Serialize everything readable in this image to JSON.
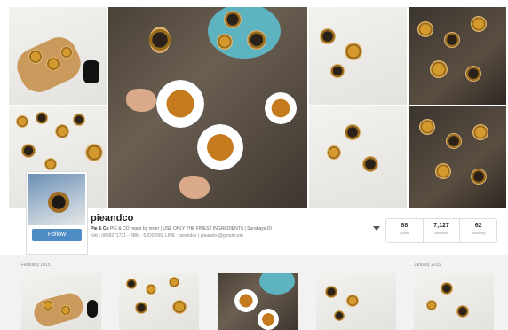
{
  "profile": {
    "username": "pieandco",
    "follow_label": "Follow",
    "bio_name": "Pie & Co",
    "bio_text": "PIE & CO made by order | USE ONLY THE FINEST INGREDIENTS | Surabaya ID",
    "bio_contact": "Kiki : 0838271731 - BBM : 52D02083 LINE : pieandco | pieandco@gmail.com"
  },
  "stats": [
    {
      "value": "88",
      "label": "posts"
    },
    {
      "value": "7,127",
      "label": "followers"
    },
    {
      "value": "62",
      "label": "following"
    }
  ],
  "grid": {
    "left_month": "February 2015",
    "right_month": "January 2015"
  },
  "colors": {
    "follow_button": "#4f8bc5",
    "plate_teal": "#5db3bf",
    "wood_dark": "#4a4137"
  }
}
